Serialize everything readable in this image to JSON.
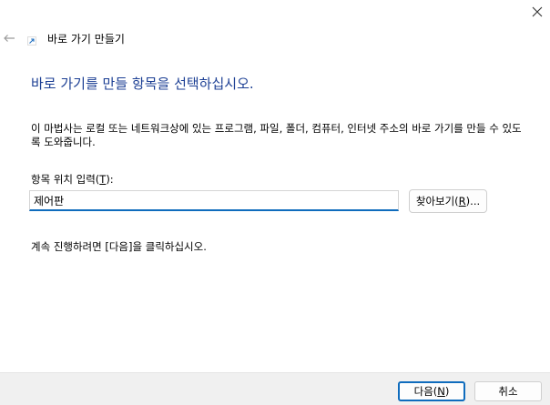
{
  "window": {
    "close_symbol": "✕",
    "back_symbol": "←"
  },
  "wizard": {
    "title": "바로 가기 만들기",
    "heading": "바로 가기를 만들 항목을 선택하십시오.",
    "description": "이 마법사는 로컬 또는 네트워크상에 있는 프로그램, 파일, 폴더, 컴퓨터, 인터넷 주소의 바로 가기를 만들 수 있도록 도와줍니다.",
    "location_label_prefix": "항목 위치 입력(",
    "location_label_mnemonic": "T",
    "location_label_suffix": "):",
    "location_value": "제어판",
    "browse_prefix": "찾아보기(",
    "browse_mnemonic": "R",
    "browse_suffix": ")...",
    "continue_instruction": "계속 진행하려면 [다음]을 클릭하십시오."
  },
  "footer": {
    "next_prefix": "다음(",
    "next_mnemonic": "N",
    "next_suffix": ")",
    "cancel_label": "취소"
  },
  "colors": {
    "heading": "#1c3f94",
    "accent": "#0f6cbd",
    "footer_bg": "#f0f0f0"
  },
  "icons": {
    "close": "close-icon",
    "back": "back-arrow-icon",
    "wizard": "shortcut-wizard-icon"
  }
}
